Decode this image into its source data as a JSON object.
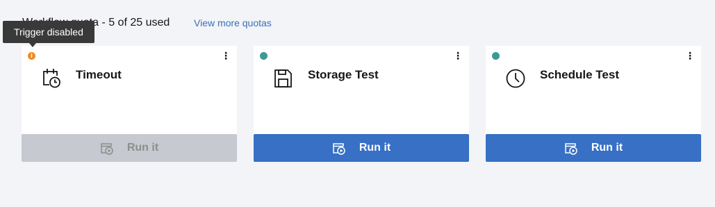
{
  "quota": {
    "text": "Workflow quota - 5 of 25 used",
    "link": "View more quotas"
  },
  "tooltip": {
    "text": "Trigger disabled"
  },
  "colors": {
    "primary": "#3770c4",
    "disabled": "#c6c9cf",
    "status_active": "#3a9a94",
    "status_warning": "#f08a24"
  },
  "cards": [
    {
      "title": "Timeout",
      "icon": "calendar-clock-icon",
      "status": "warning",
      "status_glyph": "i",
      "run_label": "Run it",
      "disabled": true
    },
    {
      "title": "Storage Test",
      "icon": "save-icon",
      "status": "active",
      "run_label": "Run it",
      "disabled": false
    },
    {
      "title": "Schedule Test",
      "icon": "clock-icon",
      "status": "active",
      "run_label": "Run it",
      "disabled": false
    }
  ]
}
